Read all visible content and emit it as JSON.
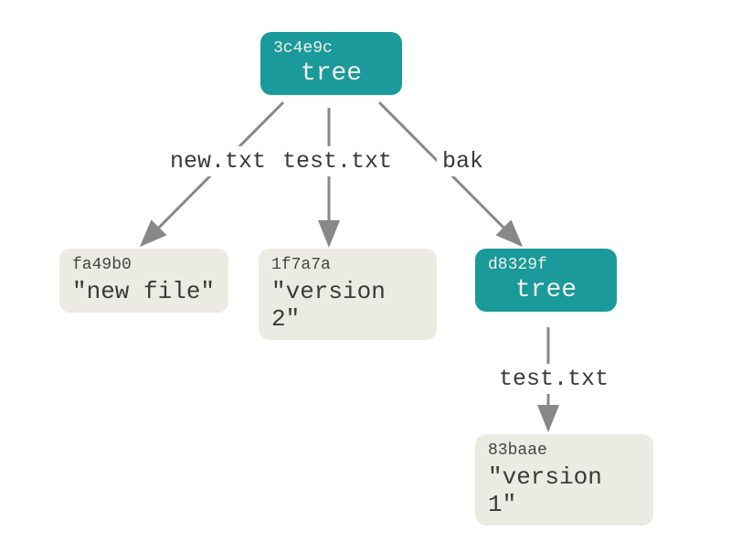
{
  "nodes": {
    "root": {
      "hash": "3c4e9c",
      "type": "tree"
    },
    "blob_new": {
      "hash": "fa49b0",
      "content": "\"new file\""
    },
    "blob_v2": {
      "hash": "1f7a7a",
      "content": "\"version 2\""
    },
    "subtree": {
      "hash": "d8329f",
      "type": "tree"
    },
    "blob_v1": {
      "hash": "83baae",
      "content": "\"version 1\""
    }
  },
  "edges": {
    "new_txt": "new.txt",
    "test_txt": "test.txt",
    "bak": "bak",
    "sub_test_txt": "test.txt"
  },
  "colors": {
    "tree": "#1a9a9a",
    "blob": "#ebebe3",
    "arrow": "#888888"
  }
}
